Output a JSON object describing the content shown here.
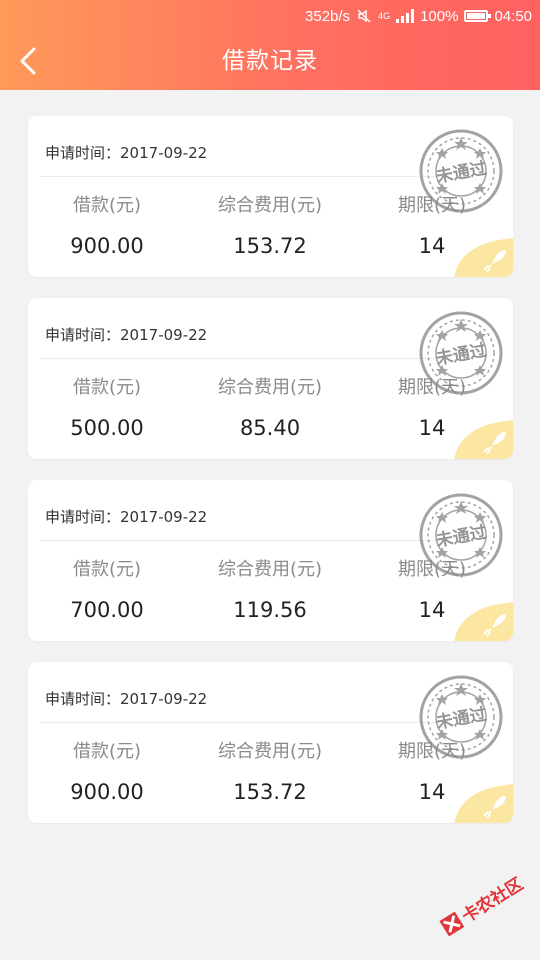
{
  "status_bar": {
    "network_speed": "352b/s",
    "network_type": "4G",
    "battery": "100%",
    "time": "04:50"
  },
  "header": {
    "title": "借款记录"
  },
  "labels": {
    "date_prefix": "申请时间：",
    "amount": "借款(元)",
    "fee": "综合费用(元)",
    "term": "期限(天)"
  },
  "stamp": {
    "text": "未通过",
    "color": "#9a9a9a"
  },
  "records": [
    {
      "date": "2017-09-22",
      "amount": "900.00",
      "fee": "153.72",
      "term": "14"
    },
    {
      "date": "2017-09-22",
      "amount": "500.00",
      "fee": "85.40",
      "term": "14"
    },
    {
      "date": "2017-09-22",
      "amount": "700.00",
      "fee": "119.56",
      "term": "14"
    },
    {
      "date": "2017-09-22",
      "amount": "900.00",
      "fee": "153.72",
      "term": "14"
    }
  ],
  "watermark": {
    "text": "卡农社区"
  },
  "colors": {
    "header_start": "#ff9a5a",
    "header_end": "#ff6160",
    "corner_badge": "#fbe6a2"
  }
}
